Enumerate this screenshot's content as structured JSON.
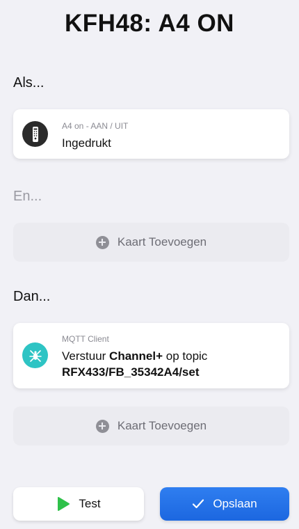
{
  "header": {
    "title": "KFH48: A4 ON"
  },
  "sections": {
    "if_label": "Als...",
    "and_label": "En...",
    "then_label": "Dan..."
  },
  "trigger_card": {
    "icon": "remote-control-icon",
    "subtitle": "A4 on - AAN / UIT",
    "text": "Ingedrukt"
  },
  "condition_add": {
    "label": "Kaart Toevoegen",
    "icon": "plus-circle-icon"
  },
  "action_card": {
    "icon": "mqtt-icon",
    "subtitle": "MQTT Client",
    "text_prefix": "Verstuur ",
    "text_bold": "Channel+",
    "text_suffix": " op topic",
    "topic": "RFX433/FB_35342A4/set"
  },
  "action_add": {
    "label": "Kaart Toevoegen",
    "icon": "plus-circle-icon"
  },
  "footer": {
    "test_label": "Test",
    "save_label": "Opslaan"
  },
  "colors": {
    "background": "#f1f1f6",
    "trigger_icon_bg": "#2b2b2b",
    "mqtt_icon_bg": "#2ec4c4",
    "play_green": "#2fc14a",
    "save_blue": "#2377ea"
  }
}
